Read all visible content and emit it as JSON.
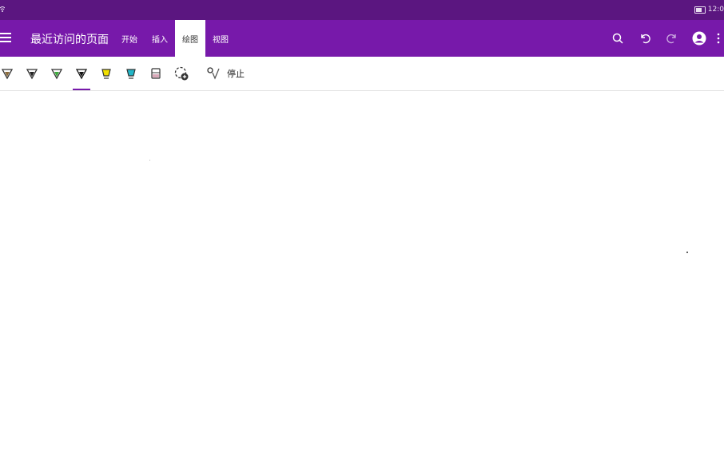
{
  "statusbar": {
    "time": "12:0"
  },
  "appbar": {
    "title": "最近访问的页面",
    "tabs": [
      {
        "label": "开始"
      },
      {
        "label": "插入"
      },
      {
        "label": "绘图"
      },
      {
        "label": "视图"
      }
    ],
    "active_tab": "绘图",
    "icons": [
      "search-icon",
      "undo-icon",
      "redo-icon",
      "account-icon",
      "more-options-icon"
    ]
  },
  "toolbar": {
    "pens": [
      {
        "name": "pen-brown",
        "color": "#8a6a3a",
        "selected": false
      },
      {
        "name": "pen-black",
        "color": "#222222",
        "selected": false
      },
      {
        "name": "pen-green",
        "color": "#3caa3c",
        "selected": false
      },
      {
        "name": "pen-black-selected",
        "color": "#111111",
        "selected": true
      },
      {
        "name": "highlighter-yellow",
        "color": "#f2e000",
        "selected": false
      },
      {
        "name": "highlighter-cyan",
        "color": "#22b6c8",
        "selected": false
      },
      {
        "name": "pencil-pink",
        "color": "#d8a8b8",
        "selected": false
      },
      {
        "name": "add-pen",
        "color": "#333333",
        "selected": false
      }
    ],
    "stop_label": "停止"
  },
  "colors": {
    "accent": "#7719aa",
    "statusbar": "#5b1680"
  }
}
